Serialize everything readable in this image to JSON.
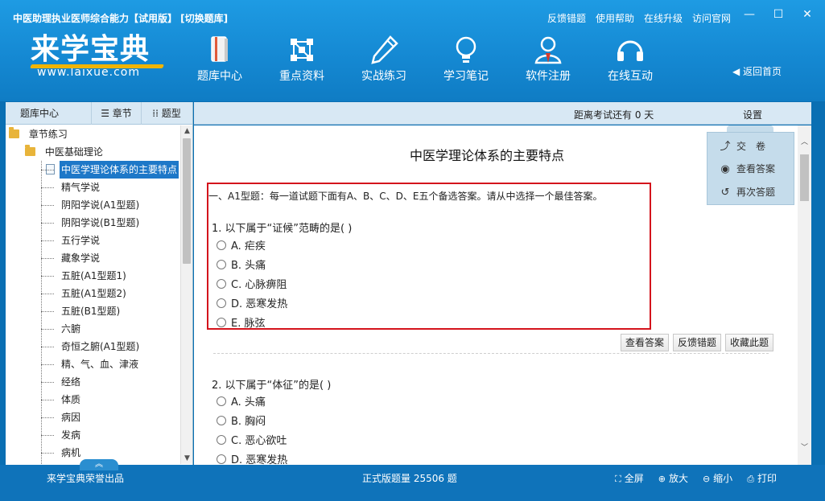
{
  "header": {
    "title": "中医助理执业医师综合能力【试用版】 [切换题库]",
    "links": [
      "反馈错题",
      "使用帮助",
      "在线升级",
      "访问官网"
    ],
    "window_controls": [
      "minimize-icon",
      "maximize-icon",
      "close-icon"
    ],
    "logo": {
      "main": "来学宝典",
      "sub": "www.laixue.com"
    },
    "nav": [
      {
        "label": "题库中心",
        "icon": "book-icon"
      },
      {
        "label": "重点资料",
        "icon": "network-icon"
      },
      {
        "label": "实战练习",
        "icon": "pencil-icon"
      },
      {
        "label": "学习笔记",
        "icon": "bulb-icon"
      },
      {
        "label": "软件注册",
        "icon": "user-icon"
      },
      {
        "label": "在线互动",
        "icon": "headset-icon"
      }
    ],
    "back_home": "返回首页"
  },
  "sidebar": {
    "tabs": {
      "center": "题库中心",
      "chapter": "章节",
      "type": "题型"
    },
    "tree": {
      "root": "章节练习",
      "folder": "中医基础理论",
      "items": [
        "中医学理论体系的主要特点",
        "精气学说",
        "阴阳学说(A1型题)",
        "阴阳学说(B1型题)",
        "五行学说",
        "藏象学说",
        "五脏(A1型题1)",
        "五脏(A1型题2)",
        "五脏(B1型题)",
        "六腑",
        "奇恒之腑(A1型题)",
        "精、气、血、津液",
        "经络",
        "体质",
        "病因",
        "发病",
        "病机"
      ],
      "selected_index": 0
    }
  },
  "main": {
    "countdown": "距离考试还有 0 天",
    "settings": "设置",
    "title": "中医学理论体系的主要特点",
    "section": "一、A1型题：每一道试题下面有A、B、C、D、E五个备选答案。请从中选择一个最佳答案。",
    "questions": [
      {
        "text": "1. 以下属于“证候”范畴的是( )",
        "options": [
          "A. 疟疾",
          "B. 头痛",
          "C. 心脉痹阻",
          "D. 恶寒发热",
          "E. 脉弦"
        ]
      },
      {
        "text": "2. 以下属于“体征”的是( )",
        "options": [
          "A. 头痛",
          "B. 胸闷",
          "C. 恶心欲吐",
          "D. 恶寒发热"
        ]
      }
    ],
    "q_actions": [
      "查看答案",
      "反馈错题",
      "收藏此题"
    ],
    "float_panel": [
      {
        "label": "交　卷",
        "icon": "submit-icon"
      },
      {
        "label": "查看答案",
        "icon": "eye-icon"
      },
      {
        "label": "再次答题",
        "icon": "redo-icon"
      }
    ]
  },
  "footer": {
    "brand": "来学宝典荣誉出品",
    "count": "正式版题量  25506  题",
    "tools": [
      {
        "label": "全屏",
        "icon": "fullscreen-icon"
      },
      {
        "label": "放大",
        "icon": "zoom-in-icon"
      },
      {
        "label": "缩小",
        "icon": "zoom-out-icon"
      },
      {
        "label": "打印",
        "icon": "print-icon"
      }
    ]
  },
  "colors": {
    "header": "#1589d3",
    "footer": "#0f73ba",
    "accent_red": "#d4141c",
    "selected": "#1e78c8",
    "logo_swoosh": "#f0b400"
  }
}
